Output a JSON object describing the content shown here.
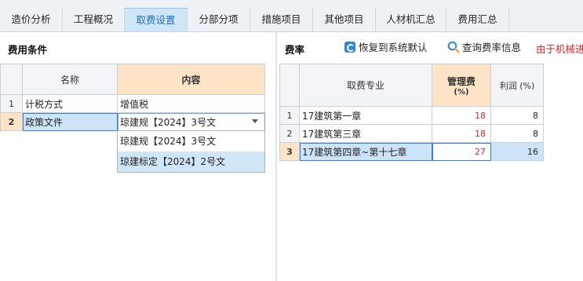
{
  "tabs": [
    {
      "label": "造价分析"
    },
    {
      "label": "工程概况"
    },
    {
      "label": "取费设置"
    },
    {
      "label": "分部分项"
    },
    {
      "label": "措施项目"
    },
    {
      "label": "其他项目"
    },
    {
      "label": "人材机汇总"
    },
    {
      "label": "费用汇总"
    }
  ],
  "left": {
    "title": "费用条件",
    "col_name": "名称",
    "col_content": "内容",
    "rows": [
      {
        "num": "1",
        "name": "计税方式",
        "content": "增值税"
      },
      {
        "num": "2",
        "name": "政策文件",
        "content": "琼建规【2024】3号文"
      }
    ],
    "dropdown_options": [
      "琼建规【2024】3号文",
      "琼建标定【2024】2号文"
    ]
  },
  "right": {
    "title": "费率",
    "restore_label": "恢复到系统默认",
    "query_label": "查询费率信息",
    "warning": "由于机械进",
    "col_major": "取费专业",
    "col_mgmt": "管理费",
    "col_mgmt_unit": "(%)",
    "col_profit": "利润 (%)",
    "rows": [
      {
        "num": "1",
        "major": "17建筑第一章",
        "mgmt": "18",
        "profit": "8"
      },
      {
        "num": "2",
        "major": "17建筑第三章",
        "mgmt": "18",
        "profit": "8"
      },
      {
        "num": "3",
        "major": "17建筑第四章~第十七章",
        "mgmt": "27",
        "profit": "16"
      }
    ]
  },
  "colors": {
    "accent": "#1f6fb8",
    "selected_header": "#fde4c6",
    "selected_cell": "#cde3f7",
    "red": "#d9262a"
  }
}
